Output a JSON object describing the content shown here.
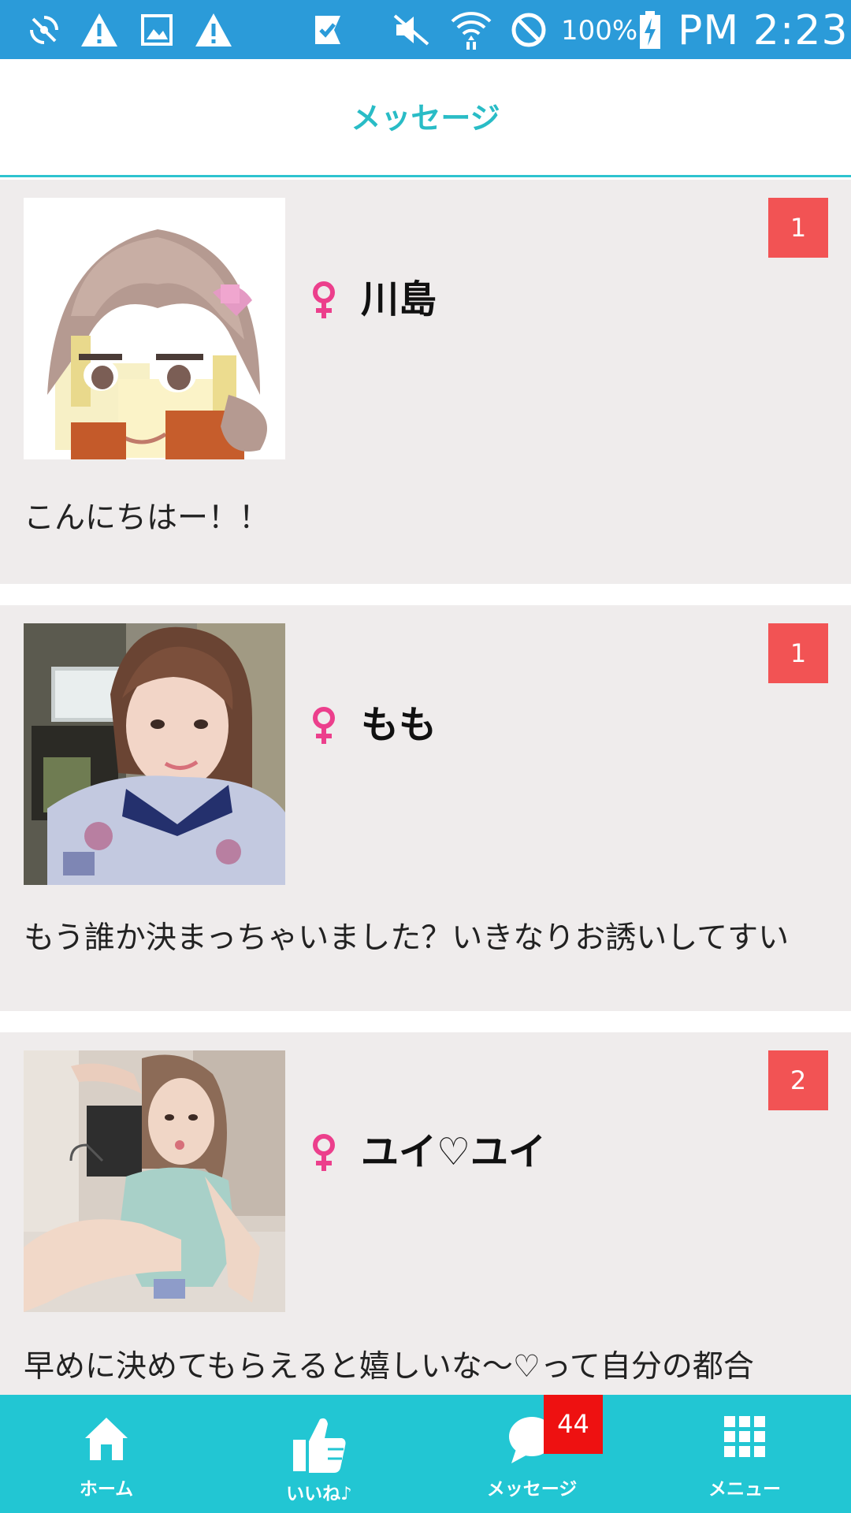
{
  "status_bar": {
    "battery_percent": "100%",
    "time": "PM 2:23",
    "icons": [
      "sync-off-icon",
      "warning-icon",
      "image-icon",
      "warning-icon",
      "check-flag-icon",
      "mute-icon",
      "wifi-icon",
      "block-icon",
      "battery-charging-icon"
    ]
  },
  "header": {
    "title": "メッセージ"
  },
  "threads": [
    {
      "name": "川島",
      "unread": "1",
      "preview": "こんにちはー！！",
      "gender_icon": "female-icon",
      "avatar": "anime-girl-pixel-avatar"
    },
    {
      "name": "もも",
      "unread": "1",
      "preview": "もう誰か決まっちゃいました？いきなりお誘いしてすい",
      "gender_icon": "female-icon",
      "avatar": "photo-avatar"
    },
    {
      "name": "ユイ♡ユイ",
      "unread": "2",
      "preview": "早めに決めてもらえると嬉しいな〜♡って自分の都合",
      "gender_icon": "female-icon",
      "avatar": "photo-avatar"
    }
  ],
  "bottom_nav": {
    "items": [
      {
        "label": "ホーム",
        "icon": "home-icon"
      },
      {
        "label": "いいね♪",
        "icon": "thumbs-up-icon"
      },
      {
        "label": "メッセージ",
        "icon": "chat-bubble-icon"
      },
      {
        "label": "メニュー",
        "icon": "grid-menu-icon"
      }
    ],
    "message_badge": "44"
  },
  "colors": {
    "status_bar": "#2b9bd9",
    "accent": "#29bcc6",
    "nav_background": "#22c6d3",
    "unread_badge": "#f25354",
    "nav_badge": "#ee1111",
    "female": "#ec3f8c",
    "row_background": "#efecec"
  }
}
